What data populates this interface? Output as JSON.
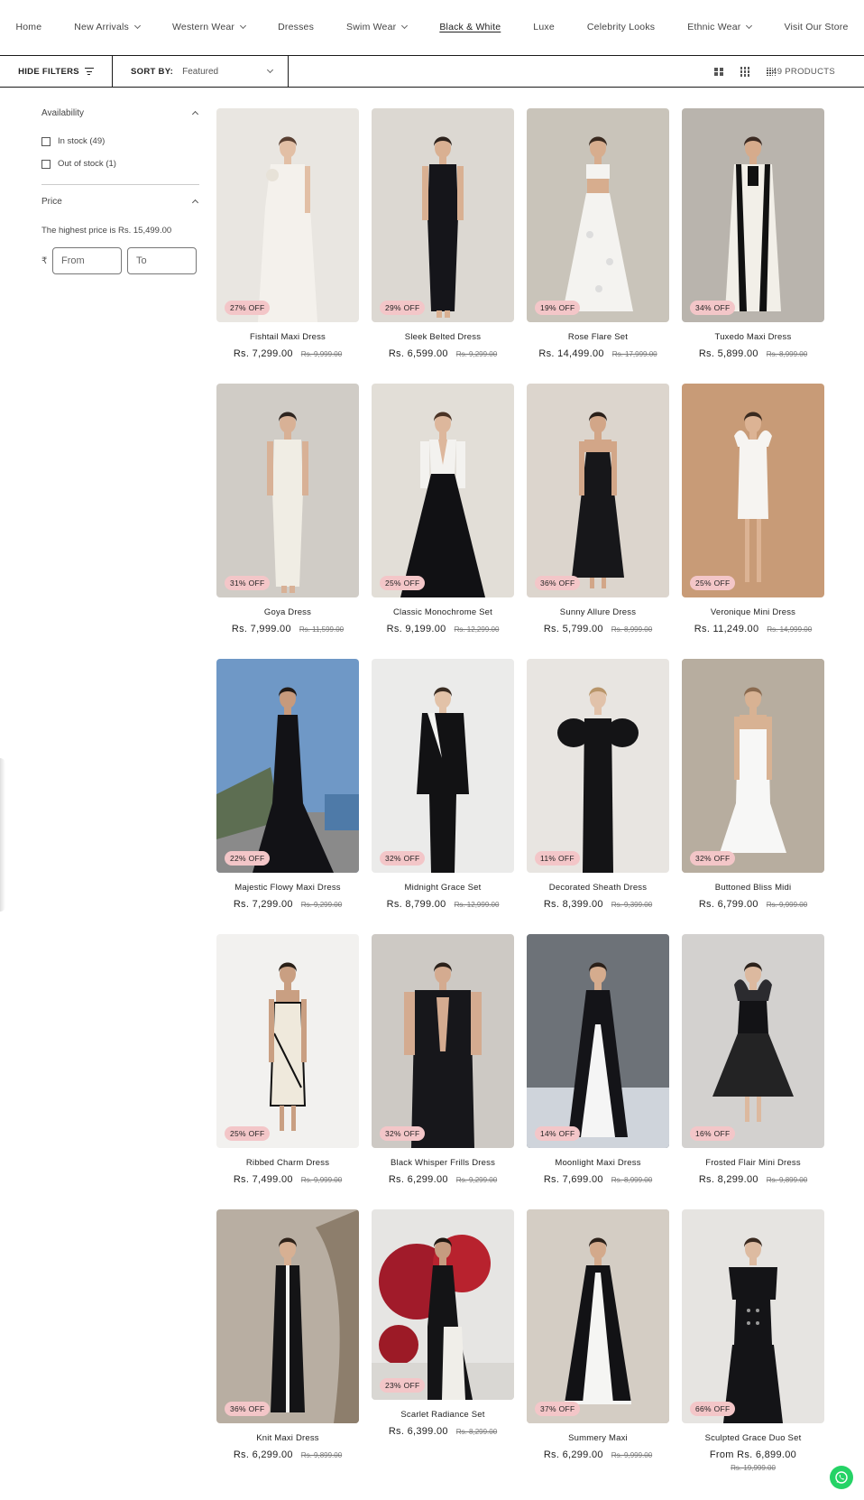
{
  "nav": [
    {
      "label": "Home",
      "dropdown": false,
      "active": false
    },
    {
      "label": "New Arrivals",
      "dropdown": true,
      "active": false
    },
    {
      "label": "Western Wear",
      "dropdown": true,
      "active": false
    },
    {
      "label": "Dresses",
      "dropdown": false,
      "active": false
    },
    {
      "label": "Swim Wear",
      "dropdown": true,
      "active": false
    },
    {
      "label": "Black & White",
      "dropdown": false,
      "active": true
    },
    {
      "label": "Luxe",
      "dropdown": false,
      "active": false
    },
    {
      "label": "Celebrity Looks",
      "dropdown": false,
      "active": false
    },
    {
      "label": "Ethnic Wear",
      "dropdown": true,
      "active": false
    },
    {
      "label": "Visit Our Store",
      "dropdown": false,
      "active": false
    }
  ],
  "toolbar": {
    "hide_filters": "HIDE FILTERS",
    "sort_label": "SORT BY:",
    "sort_value": "Featured",
    "products_count": "49 PRODUCTS"
  },
  "filters": {
    "availability_title": "Availability",
    "in_stock": "In stock (49)",
    "out_of_stock": "Out of stock (1)",
    "price_title": "Price",
    "price_note": "The highest price is Rs. 15,499.00",
    "currency": "₹",
    "from_placeholder": "From",
    "to_placeholder": "To"
  },
  "products": [
    {
      "title": "Fishtail Maxi Dress",
      "price": "Rs. 7,299.00",
      "compare": "Rs. 9,999.00",
      "badge": "27% OFF",
      "bg": "#e9e6e1",
      "dress": "#f4f1ec",
      "skin": "#e2bfa5",
      "hair": "#5a4032",
      "style": "gown"
    },
    {
      "title": "Sleek Belted Dress",
      "price": "Rs. 6,599.00",
      "compare": "Rs. 9,299.00",
      "badge": "29% OFF",
      "bg": "#dcd8d2",
      "dress": "#15151a",
      "skin": "#d9b092",
      "hair": "#2d221c",
      "style": "column"
    },
    {
      "title": "Rose Flare Set",
      "price": "Rs. 14,499.00",
      "compare": "Rs. 17,999.00",
      "badge": "19% OFF",
      "bg": "#c9c4ba",
      "dress": "#f4f3f0",
      "skin": "#d7ad8e",
      "hair": "#3a2a20",
      "style": "flare"
    },
    {
      "title": "Tuxedo Maxi Dress",
      "price": "Rs. 5,899.00",
      "compare": "Rs. 8,999.00",
      "badge": "34% OFF",
      "bg": "#b9b4ad",
      "dress": "#f2efe8",
      "skin": "#d6ab8c",
      "hair": "#3b2a22",
      "style": "tux"
    },
    {
      "title": "Goya Dress",
      "price": "Rs. 7,999.00",
      "compare": "Rs. 11,599.00",
      "badge": "31% OFF",
      "bg": "#d0ccc6",
      "dress": "#f0ede4",
      "skin": "#d8b196",
      "hair": "#2e2520",
      "style": "column"
    },
    {
      "title": "Classic Monochrome Set",
      "price": "Rs. 9,199.00",
      "compare": "Rs. 12,299.00",
      "badge": "25% OFF",
      "bg": "#e2ded7",
      "dress": "#111114",
      "skin": "#ddb79c",
      "hair": "#4a3325",
      "style": "ballgown"
    },
    {
      "title": "Sunny Allure Dress",
      "price": "Rs. 5,799.00",
      "compare": "Rs. 8,999.00",
      "badge": "36% OFF",
      "bg": "#dcd5cd",
      "dress": "#17171a",
      "skin": "#d2a688",
      "hair": "#2a201a",
      "style": "slip"
    },
    {
      "title": "Veronique Mini Dress",
      "price": "Rs. 11,249.00",
      "compare": "Rs. 14,999.00",
      "badge": "25% OFF",
      "bg": "#c89b77",
      "dress": "#f6f4f1",
      "skin": "#dcb394",
      "hair": "#3a2a1f",
      "style": "mini"
    },
    {
      "title": "Majestic Flowy Maxi Dress",
      "price": "Rs. 7,299.00",
      "compare": "Rs. 9,299.00",
      "badge": "22% OFF",
      "bg": "#6f98c6",
      "dress": "#121216",
      "skin": "#c79a7c",
      "hair": "#221a16",
      "style": "beach"
    },
    {
      "title": "Midnight Grace Set",
      "price": "Rs. 8,799.00",
      "compare": "Rs. 12,999.00",
      "badge": "32% OFF",
      "bg": "#ebebea",
      "dress": "#121214",
      "skin": "#e2c2a8",
      "hair": "#3a2c22",
      "style": "blazer"
    },
    {
      "title": "Decorated Sheath Dress",
      "price": "Rs. 8,399.00",
      "compare": "Rs. 9,399.00",
      "badge": "11% OFF",
      "bg": "#e8e5e1",
      "dress": "#141416",
      "skin": "#e1c2aa",
      "hair": "#b8956a",
      "style": "puff"
    },
    {
      "title": "Buttoned Bliss Midi",
      "price": "Rs. 6,799.00",
      "compare": "Rs. 9,999.00",
      "badge": "32% OFF",
      "bg": "#bdb4aa",
      "dress": "#f7f7f6",
      "skin": "#d8b293",
      "hair": "#8a6a4f",
      "style": "strapless"
    },
    {
      "title": "Ribbed Charm Dress",
      "price": "Rs. 7,499.00",
      "compare": "Rs. 9,999.00",
      "badge": "25% OFF",
      "bg": "#f2f1ef",
      "dress": "#efe9dc",
      "skin": "#c99f82",
      "hair": "#2a2018",
      "style": "wrap"
    },
    {
      "title": "Black Whisper Frills Dress",
      "price": "Rs. 6,299.00",
      "compare": "Rs. 9,299.00",
      "badge": "32% OFF",
      "bg": "#cdc9c4",
      "dress": "#17171b",
      "skin": "#d4ab90",
      "hair": "#2a201a",
      "style": "halter"
    },
    {
      "title": "Moonlight Maxi Dress",
      "price": "Rs. 7,699.00",
      "compare": "Rs. 8,999.00",
      "badge": "14% OFF",
      "bg": "#8e939a",
      "dress": "#141418",
      "skin": "#d5ac8e",
      "hair": "#2b2019",
      "style": "moon"
    },
    {
      "title": "Frosted Flair Mini Dress",
      "price": "Rs. 8,299.00",
      "compare": "Rs. 9,899.00",
      "badge": "16% OFF",
      "bg": "#d3d1cf",
      "dress": "#131316",
      "skin": "#dcb99f",
      "hair": "#2b211b",
      "style": "tulle"
    },
    {
      "title": "Knit Maxi Dress",
      "price": "Rs. 6,299.00",
      "compare": "Rs. 9,899.00",
      "badge": "36% OFF",
      "bg": "#b8aea2",
      "dress": "#141416",
      "skin": "#d7b093",
      "hair": "#2e2219",
      "style": "knit"
    },
    {
      "title": "Scarlet Radiance Set",
      "price": "Rs. 6,399.00",
      "compare": "Rs. 8,299.00",
      "badge": "23% OFF",
      "bg": "#e6e5e3",
      "dress": "#141416",
      "skin": "#c69c80",
      "hair": "#201812",
      "style": "scarlet"
    },
    {
      "title": "Summery Maxi",
      "price": "Rs. 6,299.00",
      "compare": "Rs. 9,999.00",
      "badge": "37% OFF",
      "bg": "#bab3ab",
      "dress": "#121215",
      "skin": "#d3a98b",
      "hair": "#2c211a",
      "style": "summery"
    },
    {
      "title": "Sculpted Grace Duo Set",
      "price": "From Rs. 6,899.00",
      "compare": "Rs. 19,999.00",
      "badge": "66% OFF",
      "bg": "#e6e4e1",
      "dress": "#141417",
      "skin": "#ddbba1",
      "hair": "#3a2a20",
      "style": "duo"
    }
  ]
}
